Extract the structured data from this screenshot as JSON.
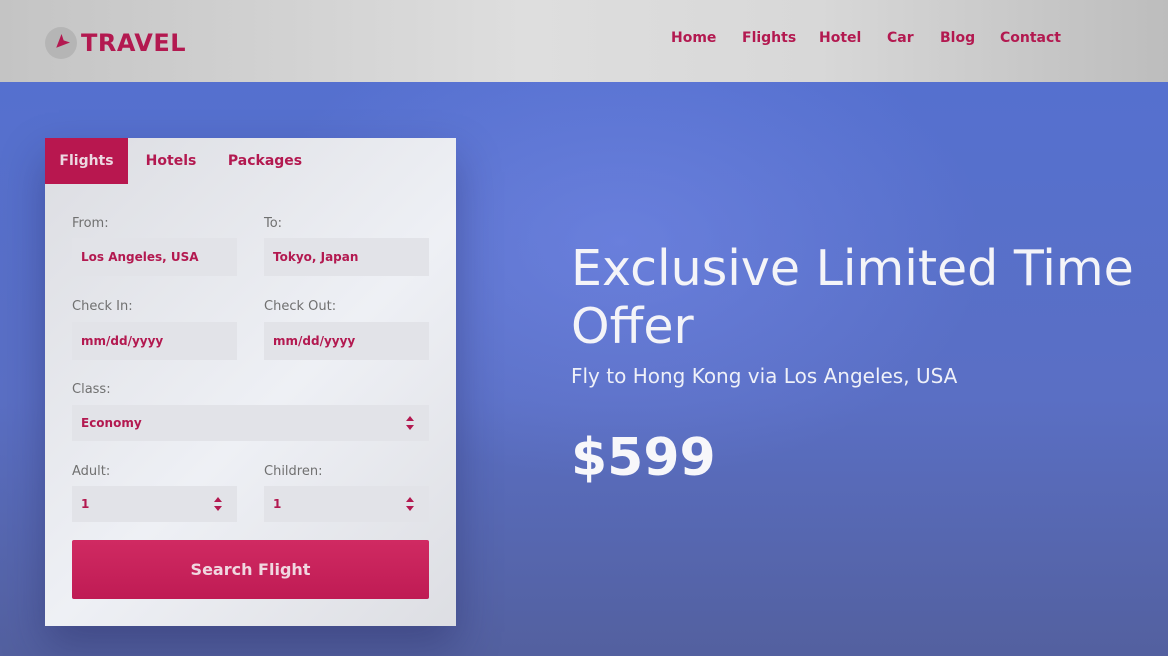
{
  "brand": {
    "name": "TRAVEL",
    "icon": "plane-icon"
  },
  "nav": {
    "items": [
      "Home",
      "Flights",
      "Hotel",
      "Car",
      "Blog",
      "Contact"
    ]
  },
  "booking": {
    "tabs": [
      "Flights",
      "Hotels",
      "Packages"
    ],
    "active_tab": "Flights",
    "from_label": "From:",
    "from_value": "Los Angeles, USA",
    "to_label": "To:",
    "to_value": "Tokyo, Japan",
    "checkin_label": "Check In:",
    "checkin_placeholder": "mm/dd/yyyy",
    "checkout_label": "Check Out:",
    "checkout_placeholder": "mm/dd/yyyy",
    "class_label": "Class:",
    "class_value": "Economy",
    "adult_label": "Adult:",
    "adult_value": "1",
    "children_label": "Children:",
    "children_value": "1",
    "search_label": "Search Flight"
  },
  "offer": {
    "title": "Exclusive Limited Time Offer",
    "subtitle": "Fly to Hong Kong via Los Angeles, USA",
    "price": "$599"
  },
  "colors": {
    "accent": "#b31950",
    "hero": "#5a73c9",
    "header": "#d6d6d6"
  }
}
